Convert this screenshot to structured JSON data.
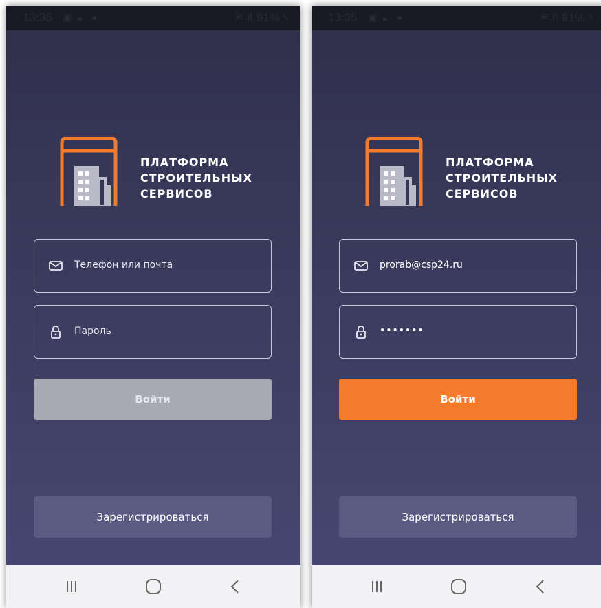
{
  "statusbar": {
    "left": {
      "time": "13:36",
      "battery": "91%"
    },
    "right": {
      "time": "13:35",
      "battery": "91%"
    }
  },
  "logo": {
    "line1": "ПЛАТФОРМА",
    "line2": "СТРОИТЕЛЬНЫХ",
    "line3": "СЕРВИСОВ",
    "colors": {
      "orange": "#f47b2b",
      "gray": "#b9b9c8",
      "white": "#ffffff"
    }
  },
  "screens": {
    "left": {
      "login_field": {
        "placeholder": "Телефон или почта",
        "value": ""
      },
      "password_field": {
        "placeholder": "Пароль",
        "value": ""
      },
      "login_button": {
        "label": "Войти",
        "state": "disabled"
      },
      "register_button": {
        "label": "Зарегистрироваться"
      }
    },
    "right": {
      "login_field": {
        "placeholder": "",
        "value": "prorab@csp24.ru"
      },
      "password_field": {
        "placeholder": "",
        "value": "•••••••"
      },
      "login_button": {
        "label": "Войти",
        "state": "enabled"
      },
      "register_button": {
        "label": "Зарегистрироваться"
      }
    }
  },
  "icons": {
    "email": "mail-icon",
    "password": "lock-icon",
    "nav_recent": "recent-apps-icon",
    "nav_home": "home-icon",
    "nav_back": "back-icon"
  },
  "colors": {
    "accent": "#f47b2b",
    "disabled_button": "#a9a9b6",
    "register_button": "#5a5a82",
    "background_top": "#2f2f4b",
    "background_bottom": "#464671"
  }
}
